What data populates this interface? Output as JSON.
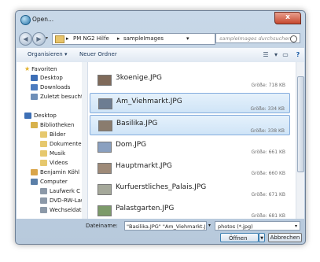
{
  "window": {
    "title": "Open...",
    "close_label": "x"
  },
  "address": {
    "crumbs": [
      "PM NG2 Hilfe",
      "sampleImages"
    ],
    "separator": "▸",
    "search_placeholder": "sampleImages durchsuchen"
  },
  "toolbar": {
    "organize_label": "Organisieren ▾",
    "new_folder_label": "Neuer Ordner"
  },
  "nav": {
    "items": [
      {
        "label": "Favoriten",
        "icon": "star-icon",
        "color": "#e2b12b"
      },
      {
        "label": "Desktop",
        "icon": "desktop-icon",
        "color": "#3d6fb6"
      },
      {
        "label": "Downloads",
        "icon": "downloads-icon",
        "color": "#4c7cc0"
      },
      {
        "label": "Zuletzt besucht",
        "icon": "recent-icon",
        "color": "#6f8fb8"
      },
      {
        "label": "Desktop",
        "icon": "desktop-icon",
        "color": "#3d6fb6"
      },
      {
        "label": "Bibliotheken",
        "icon": "library-icon",
        "color": "#d8b24c"
      },
      {
        "label": "Bilder",
        "icon": "pictures-icon",
        "color": "#e6c86e"
      },
      {
        "label": "Dokumente",
        "icon": "documents-icon",
        "color": "#e6c86e"
      },
      {
        "label": "Musik",
        "icon": "music-icon",
        "color": "#e6c86e"
      },
      {
        "label": "Videos",
        "icon": "videos-icon",
        "color": "#e6c86e"
      },
      {
        "label": "Benjamin Köhl",
        "icon": "user-icon",
        "color": "#d9a54a"
      },
      {
        "label": "Computer",
        "icon": "computer-icon",
        "color": "#5b7fa8"
      },
      {
        "label": "Laufwerk C (C:)",
        "icon": "drive-icon",
        "color": "#8c99a8"
      },
      {
        "label": "DVD-RW-Laufw",
        "icon": "dvd-icon",
        "color": "#8c99a8"
      },
      {
        "label": "Wechseldatentr",
        "icon": "drive-icon",
        "color": "#8c99a8"
      }
    ]
  },
  "files": {
    "size_prefix": "Größe: ",
    "items": [
      {
        "name": "3koenige.JPG",
        "size": "718 KB",
        "selected": false,
        "thumb": "#7f6a5a"
      },
      {
        "name": "Am_Viehmarkt.JPG",
        "size": "334 KB",
        "selected": true,
        "thumb": "#6d7d92"
      },
      {
        "name": "Basilika.JPG",
        "size": "338 KB",
        "selected": true,
        "thumb": "#8a7c6e"
      },
      {
        "name": "Dom.JPG",
        "size": "661 KB",
        "selected": false,
        "thumb": "#8aa0c0"
      },
      {
        "name": "Hauptmarkt.JPG",
        "size": "660 KB",
        "selected": false,
        "thumb": "#9e8a78"
      },
      {
        "name": "Kurfuerstliches_Palais.JPG",
        "size": "671 KB",
        "selected": false,
        "thumb": "#a5a89a"
      },
      {
        "name": "Palastgarten.JPG",
        "size": "681 KB",
        "selected": false,
        "thumb": "#7c9a6a"
      }
    ]
  },
  "bottom": {
    "filename_label": "Dateiname:",
    "filename_value": "\"Basilika.JPG\" \"Am_Viehmarkt.JPG\"",
    "filetype_value": "photos (*.jpg)",
    "open_label": "Öffnen",
    "cancel_label": "Abbrechen"
  }
}
